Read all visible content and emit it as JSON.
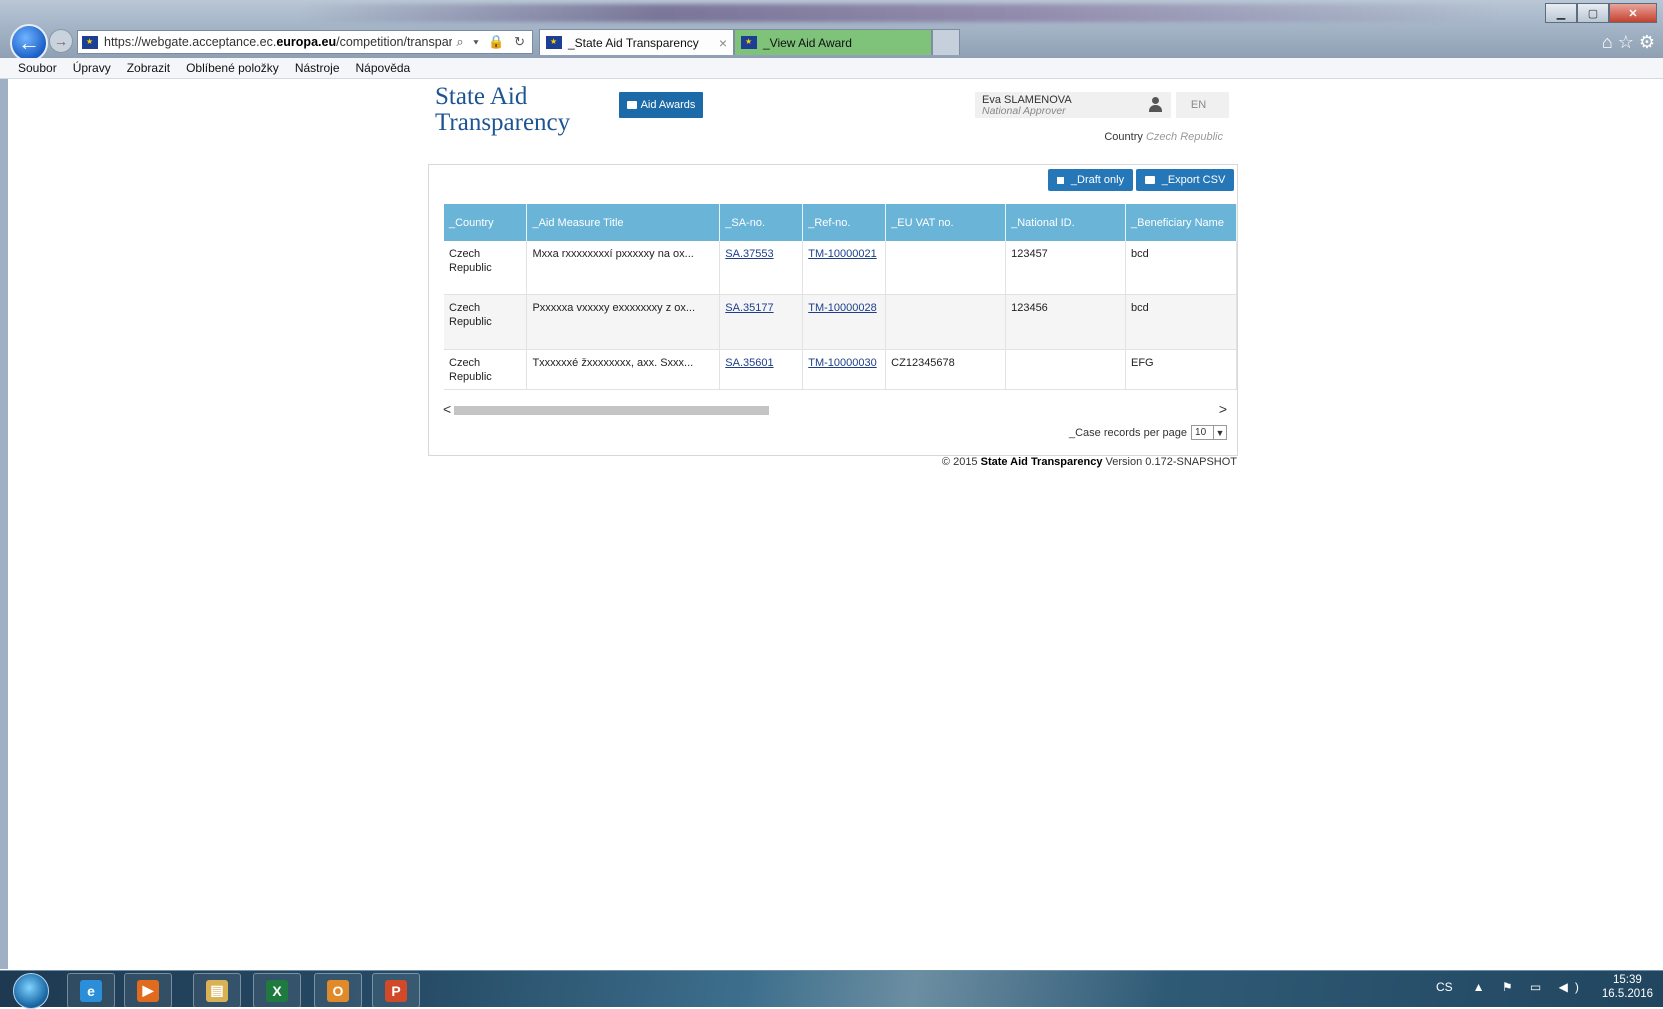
{
  "browser": {
    "url_prefix": "https://webgate.acceptance.ec.",
    "url_domain": "europa.eu",
    "url_path": "/competition/transparency/i",
    "address_icons": "⌕ ▾ 🔒 ↻",
    "tabs": [
      {
        "label": "_State Aid Transparency",
        "close": "×"
      },
      {
        "label": "_View Aid Award"
      }
    ],
    "window_controls": {
      "minimize": "▁",
      "maximize": "▢",
      "close": "✕"
    },
    "toolbar_icons": "⌂ ☆ ⚙",
    "nav": {
      "back": "←",
      "forward": "→"
    }
  },
  "menu": [
    "Soubor",
    "Úpravy",
    "Zobrazit",
    "Oblíbené položky",
    "Nástroje",
    "Nápověda"
  ],
  "app": {
    "title_line1": "State Aid",
    "title_line2": "Transparency",
    "aid_awards_label": "Aid Awards",
    "user_name": "Eva SLAMENOVA",
    "user_role": "National Approver",
    "language": "EN",
    "country_label": "Country",
    "country_value": "Czech Republic"
  },
  "panel": {
    "draft_label": "_Draft only",
    "export_label": "_Export CSV",
    "columns": [
      "_Country",
      "_Aid Measure Title",
      "_SA-no.",
      "_Ref-no.",
      "_EU VAT no.",
      "_National ID.",
      "_Beneficiary Name"
    ],
    "rows": [
      {
        "country": "Czech Republic",
        "title": "Mxxa rxxxxxxxxí pxxxxxy na ox...",
        "sa_no": "SA.37553",
        "ref_no": "TM-10000021",
        "vat": "",
        "national_id": "123457",
        "beneficiary": "bcd"
      },
      {
        "country": "Czech Republic",
        "title": "Pxxxxxa vxxxxy exxxxxxxy z ox...",
        "sa_no": "SA.35177",
        "ref_no": "TM-10000028",
        "vat": "",
        "national_id": "123456",
        "beneficiary": "bcd"
      },
      {
        "country": "Czech Republic",
        "title": "Txxxxxxé žxxxxxxxx, axx. Sxxx...",
        "sa_no": "SA.35601",
        "ref_no": "TM-10000030",
        "vat": "CZ12345678",
        "national_id": "",
        "beneficiary": "EFG"
      }
    ],
    "per_page_label": "_Case records per page",
    "per_page_value": "10",
    "scroll_left": "<",
    "scroll_right": ">"
  },
  "footer": {
    "copyright": "© 2015",
    "app_name": "State Aid Transparency",
    "version": "Version 0.172-SNAPSHOT"
  },
  "taskbar": {
    "apps": [
      {
        "name": "Internet Explorer",
        "glyph": "e",
        "color": "#2a8fd8"
      },
      {
        "name": "Media Player",
        "glyph": "▶",
        "color": "#e06b1e"
      },
      {
        "name": "File Explorer",
        "glyph": "▤",
        "color": "#d9b256"
      },
      {
        "name": "Excel",
        "glyph": "X",
        "color": "#1f7a3f"
      },
      {
        "name": "Outlook",
        "glyph": "O",
        "color": "#e08a2a"
      },
      {
        "name": "PowerPoint",
        "glyph": "P",
        "color": "#d04a2a"
      }
    ],
    "language": "CS",
    "tray_icons": "▲ ⚑ ▭ ◀)",
    "time": "15:39",
    "date": "16.5.2016"
  }
}
